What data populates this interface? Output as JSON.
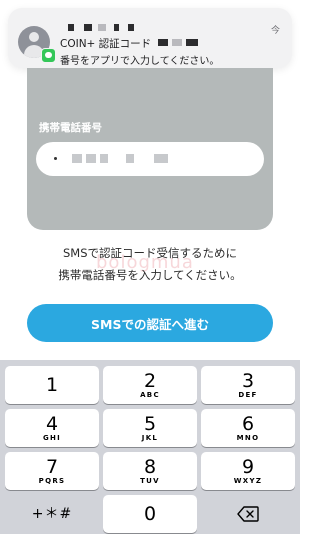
{
  "notification": {
    "title": "COIN+ 認証コード",
    "body": "番号をアプリで入力してください。",
    "time": "今"
  },
  "form": {
    "phone_label": "携帯電話番号",
    "watermark": "bologmua"
  },
  "instructions": {
    "line1": "SMSで認証コード受信するために",
    "line2": "携帯電話番号を入力してください。"
  },
  "sms_button": {
    "label": "SMSでの認証へ進む"
  },
  "keypad": {
    "keys": [
      {
        "num": "1",
        "letters": ""
      },
      {
        "num": "2",
        "letters": "ABC"
      },
      {
        "num": "3",
        "letters": "DEF"
      },
      {
        "num": "4",
        "letters": "GHI"
      },
      {
        "num": "5",
        "letters": "JKL"
      },
      {
        "num": "6",
        "letters": "MNO"
      },
      {
        "num": "7",
        "letters": "PQRS"
      },
      {
        "num": "8",
        "letters": "TUV"
      },
      {
        "num": "9",
        "letters": "WXYZ"
      },
      {
        "num": "+＊#",
        "letters": ""
      },
      {
        "num": "0",
        "letters": ""
      },
      {
        "num": "",
        "letters": ""
      }
    ],
    "backspace_icon": "backspace-icon"
  },
  "colors": {
    "accent": "#2ba8e0",
    "card": "#b4b9b9",
    "keypad_bg": "#d1d3d9"
  }
}
